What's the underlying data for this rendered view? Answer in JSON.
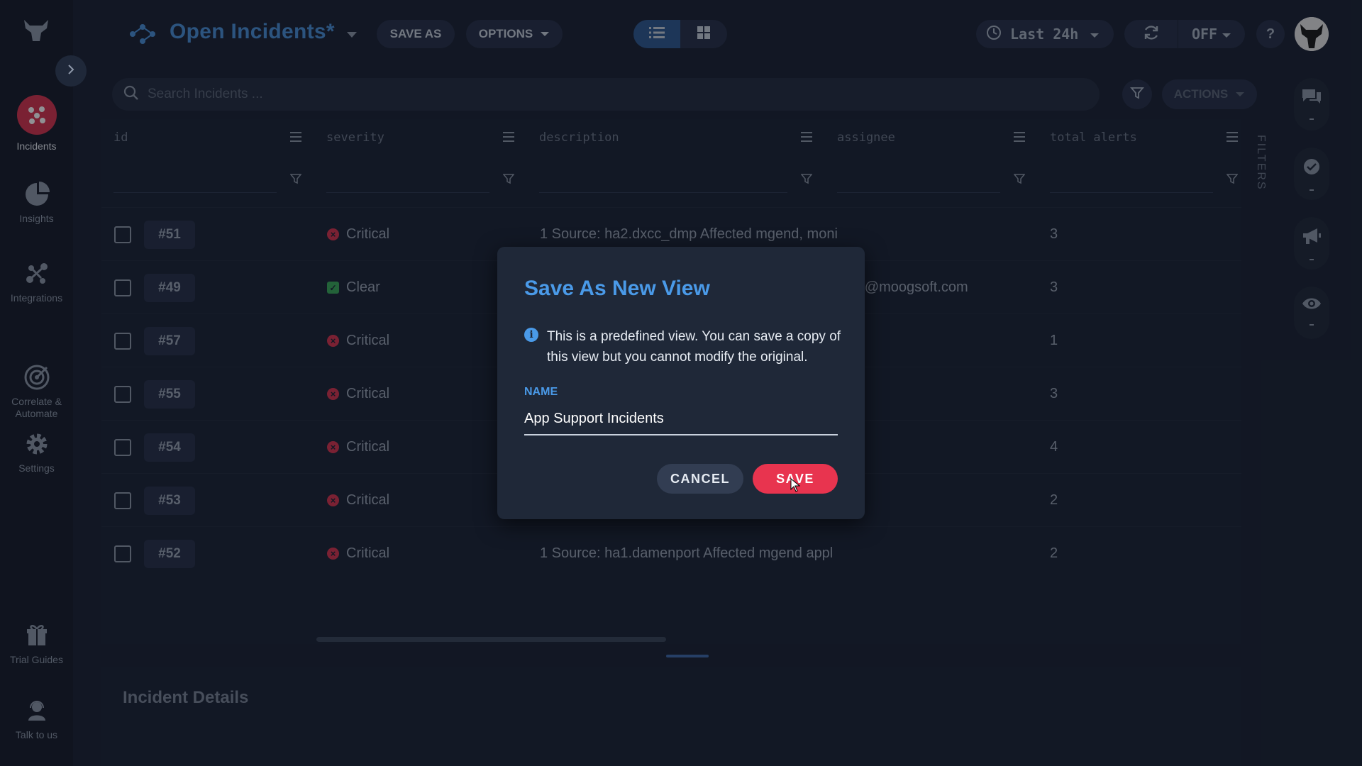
{
  "nav": {
    "items": [
      {
        "label": "Incidents",
        "icon": "incidents-icon"
      },
      {
        "label": "Insights",
        "icon": "pie-chart-icon"
      },
      {
        "label": "Integrations",
        "icon": "integrations-icon"
      },
      {
        "label": "Correlate &\nAutomate",
        "icon": "target-icon"
      },
      {
        "label": "Settings",
        "icon": "gear-icon"
      }
    ],
    "bottom": [
      {
        "label": "Trial Guides",
        "icon": "gift-icon"
      },
      {
        "label": "Talk to us",
        "icon": "support-agent-icon"
      }
    ]
  },
  "header": {
    "title": "Open Incidents*",
    "save_as": "SAVE AS",
    "options": "OPTIONS",
    "time_range": "Last 24h",
    "refresh_state": "OFF",
    "help": "?"
  },
  "search": {
    "placeholder": "Search Incidents ...",
    "actions": "ACTIONS"
  },
  "grid": {
    "columns": [
      "id",
      "severity",
      "description",
      "assignee",
      "total alerts"
    ],
    "filters_label": "FILTERS",
    "rows": [
      {
        "id": "#51",
        "severity": "Critical",
        "description": "1 Source: ha2.dxcc_dmp Affected mgend, moni",
        "assignee": "",
        "total": "3"
      },
      {
        "id": "#49",
        "severity": "Clear",
        "description": "",
        "assignee": "ersity@moogsoft.com",
        "total": "3"
      },
      {
        "id": "#57",
        "severity": "Critical",
        "description": "",
        "assignee": "",
        "total": "1"
      },
      {
        "id": "#55",
        "severity": "Critical",
        "description": "",
        "assignee": "",
        "total": "3"
      },
      {
        "id": "#54",
        "severity": "Critical",
        "description": "",
        "assignee": "",
        "total": "4"
      },
      {
        "id": "#53",
        "severity": "Critical",
        "description": "",
        "assignee": "",
        "total": "2"
      },
      {
        "id": "#52",
        "severity": "Critical",
        "description": "1 Source: ha1.damenport Affected mgend appl",
        "assignee": "",
        "total": "2"
      }
    ]
  },
  "details": {
    "title": "Incident Details"
  },
  "modal": {
    "title": "Save As New View",
    "info": "This is a predefined view. You can save a copy of this view but you cannot modify the original.",
    "name_label": "NAME",
    "name_value": "App Support Incidents",
    "cancel": "CANCEL",
    "save": "SAVE"
  },
  "colors": {
    "accent": "#4a9ae8",
    "danger": "#e8344f",
    "success": "#3aaa5a",
    "background": "#1a2233"
  }
}
